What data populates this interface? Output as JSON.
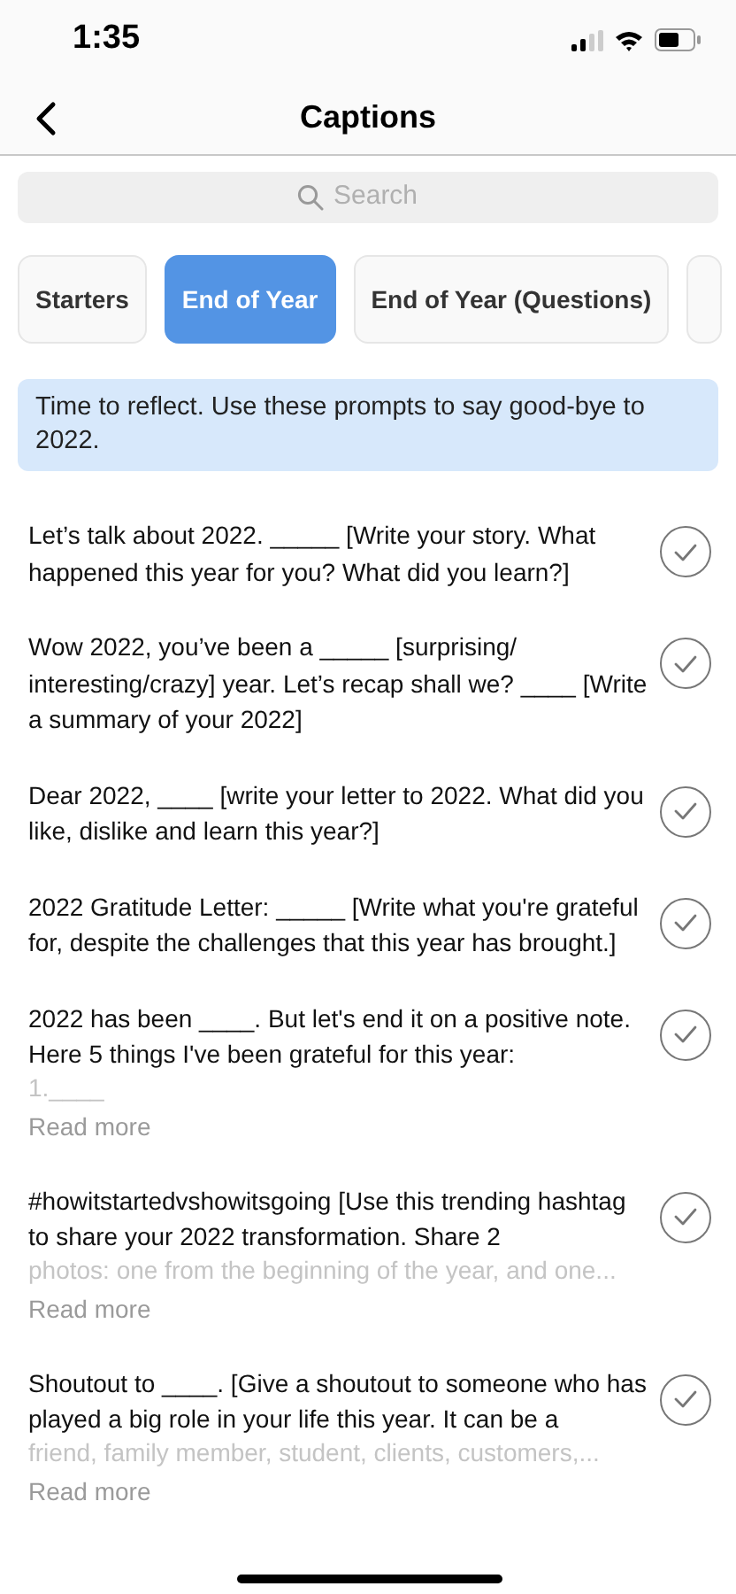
{
  "status_bar": {
    "time": "1:35"
  },
  "header": {
    "title": "Captions"
  },
  "search": {
    "placeholder": "Search"
  },
  "tabs": [
    {
      "label": "Starters",
      "selected": false
    },
    {
      "label": "End of Year",
      "selected": true
    },
    {
      "label": "End of Year (Questions)",
      "selected": false
    },
    {
      "selected": false
    }
  ],
  "banner": "Time to reflect. Use these prompts to say good-bye to 2022.",
  "captions": [
    {
      "text": "Let’s talk about 2022. _____ [Write your story. What happened this year for you? What did you learn?]"
    },
    {
      "text": "Wow 2022, you’ve been a _____ [surprising/ interesting/crazy] year. Let’s recap shall we? ____ [Write a summary of your 2022]"
    },
    {
      "text": "Dear 2022, ____ [write your letter to 2022. What did you like, dislike and learn this year?]"
    },
    {
      "text": "2022 Gratitude Letter: _____ [Write what you're grateful for, despite the challenges that this year has brought.]"
    },
    {
      "text": "2022 has been ____. But let's end it on a positive note. Here 5 things I've been grateful for this year:",
      "faded": "1.____",
      "read_more": "Read more"
    },
    {
      "text": "#howitstartedvshowitsgoing [Use this trending hashtag to share your 2022 transformation. Share 2",
      "faded": "photos: one from the beginning of the year, and one...",
      "read_more": "Read more"
    },
    {
      "text": "Shoutout to ____. [Give a shoutout to someone who has played a big role in your life this year. It can be a",
      "faded": "friend, family member, student, clients, customers,...",
      "read_more": "Read more"
    }
  ]
}
